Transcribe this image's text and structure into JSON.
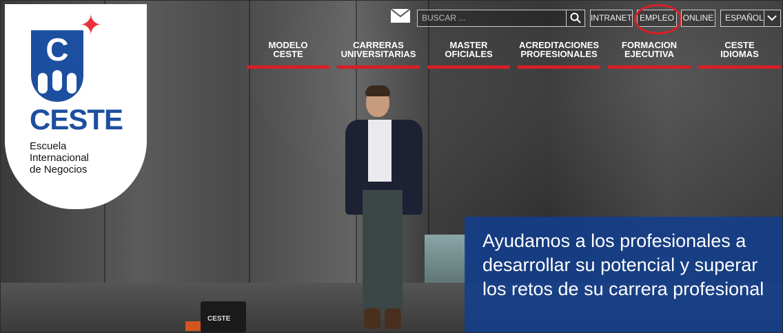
{
  "brand": {
    "name": "CESTE",
    "tagline_lines": [
      "Escuela",
      "Internacional",
      "de Negocios"
    ],
    "logo_letter": "C",
    "colors": {
      "blue": "#1d4fa0",
      "red": "#e8333b"
    }
  },
  "header": {
    "search": {
      "placeholder": "BUSCAR ..."
    },
    "buttons": {
      "intranet": "INTRANET",
      "empleo": "EMPLEO",
      "online": "ONLINE",
      "language": "ESPAÑOL"
    }
  },
  "nav": {
    "items": [
      {
        "line1": "MODELO",
        "line2": "CESTE"
      },
      {
        "line1": "CARRERAS",
        "line2": "UNIVERSITARIAS"
      },
      {
        "line1": "MASTER",
        "line2": "OFICIALES"
      },
      {
        "line1": "ACREDITACIONES",
        "line2": "PROFESIONALES"
      },
      {
        "line1": "FORMACION",
        "line2": "EJECUTIVA"
      },
      {
        "line1": "CESTE",
        "line2": "IDIOMAS"
      }
    ],
    "accent": "#d42027"
  },
  "hero": {
    "caption": "Ayudamos a los profesionales a desarrollar su potencial y superar los retos de su carrera profesional",
    "bag_label": "CESTE"
  },
  "icons": [
    "mail-icon",
    "search-icon",
    "chevron-down-icon",
    "star-icon"
  ]
}
